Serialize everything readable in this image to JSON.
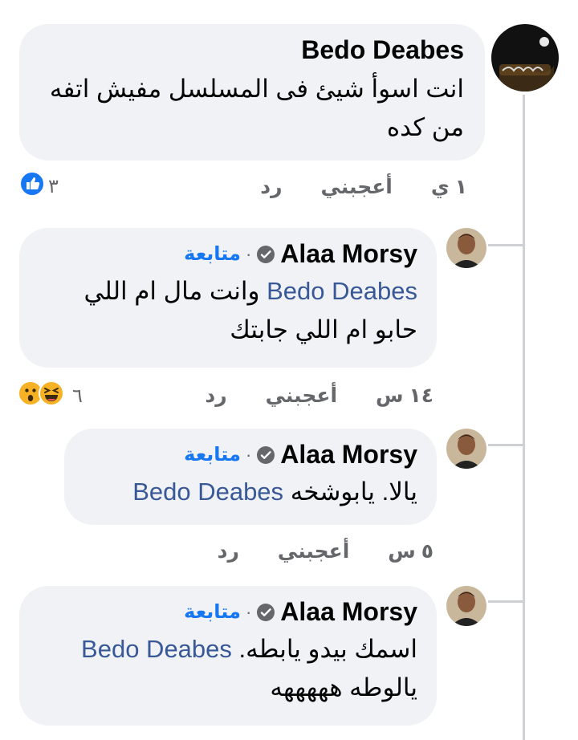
{
  "comments": [
    {
      "author": "Bedo Deabes",
      "text": "انت اسوأ شيئ فى المسلسل مفيش اتفه من كده",
      "time": "١ ي",
      "like_label": "أعجبني",
      "reply_label": "رد",
      "reaction_count": "٣",
      "reactions": [
        "like-icon"
      ]
    },
    {
      "author": "Alaa Morsy",
      "follow_label": "متابعة",
      "mention": "Bedo Deabes",
      "text": "وانت مال ام اللي حابو ام اللي جابتك",
      "time": "١٤ س",
      "like_label": "أعجبني",
      "reply_label": "رد",
      "reaction_count": "٦",
      "reactions": [
        "haha-icon",
        "wow-icon"
      ]
    },
    {
      "author": "Alaa Morsy",
      "follow_label": "متابعة",
      "mention": "Bedo Deabes",
      "text": "يالا. يابوشخه",
      "time": "٥ س",
      "like_label": "أعجبني",
      "reply_label": "رد"
    },
    {
      "author": "Alaa Morsy",
      "follow_label": "متابعة",
      "mention": "Bedo Deabes",
      "text_part1": "اسمك بيدو يابطه.",
      "text_part2": "يالوطه هههههه"
    }
  ],
  "dot_separator": "·",
  "colors": {
    "bubble": "#f0f2f5",
    "link": "#1877f2",
    "mention": "#385898",
    "meta": "#65676b",
    "thread": "#ced0d4"
  }
}
